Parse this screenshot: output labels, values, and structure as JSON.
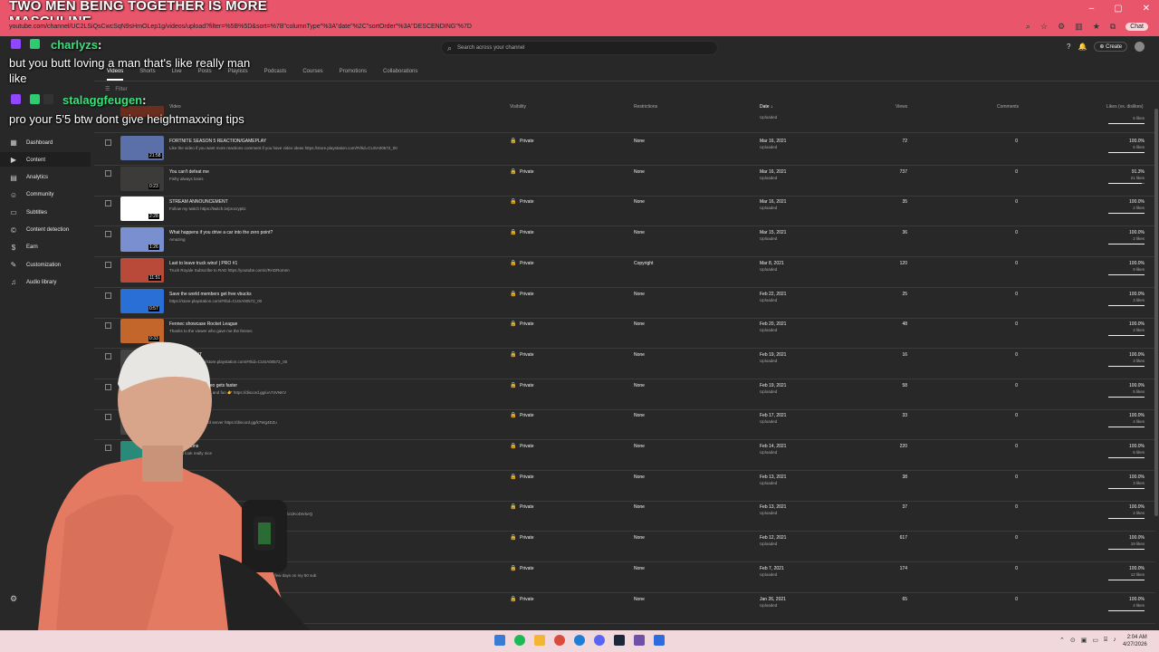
{
  "overlay": {
    "stream_title_line1": "TWO MEN BEING TOGETHER IS MORE",
    "stream_title_line2": "MASCULINE",
    "chat": [
      {
        "user": "charlyzs",
        "colon": ":",
        "msg_line1": "but you butt loving a man that's like really man",
        "msg_line2": "like"
      },
      {
        "user": "stalaggfeugen",
        "colon": ":",
        "msg_line1": "pro your 5'5 btw dont give heightmaxxing tips"
      }
    ]
  },
  "browser": {
    "url": "youtube.com/channel/UC2LSiQsCwcSqN9sHmOLep1g/videos/upload?filter=%5B%5D&sort=%7B\"columnType\"%3A\"date\"%2C\"sortOrder\"%3A\"DESCENDING\"%7D",
    "chat_btn": "Chat",
    "win_min": "–",
    "win_max": "▢",
    "win_close": "✕"
  },
  "header": {
    "search_placeholder": "Search across your channel",
    "create_label": "Create",
    "help_icon": "?",
    "bell_icon": "🔔"
  },
  "sidebar": {
    "items": [
      {
        "label": "Dashboard",
        "icon": "▦"
      },
      {
        "label": "Content",
        "icon": "▶"
      },
      {
        "label": "Analytics",
        "icon": "▤"
      },
      {
        "label": "Community",
        "icon": "☺"
      },
      {
        "label": "Subtitles",
        "icon": "▭"
      },
      {
        "label": "Content detection",
        "icon": "©"
      },
      {
        "label": "Earn",
        "icon": "$"
      },
      {
        "label": "Customization",
        "icon": "✎"
      },
      {
        "label": "Audio library",
        "icon": "♫"
      }
    ],
    "gear": "⚙"
  },
  "tabs": [
    "Videos",
    "Shorts",
    "Live",
    "Posts",
    "Playlists",
    "Podcasts",
    "Courses",
    "Promotions",
    "Collaborations"
  ],
  "filter_label": "Filter",
  "columns": {
    "video": "Video",
    "visibility": "Visibility",
    "restrictions": "Restrictions",
    "date": "Date ↓",
    "views": "Views",
    "comments": "Comments",
    "likes": "Likes (vs. dislikes)"
  },
  "partial_row": {
    "status": "Uploaded",
    "likecnt": "5 likes"
  },
  "rows": [
    {
      "title": "FORTNITE SEASON 5 REACTION/GAMEPLAY",
      "desc": "Like the video if you want more reactions comment if you have video ideas https://store.playstation.com/#!/tid=CUSA00572_00",
      "dur": "21:58",
      "vis": "Private",
      "restr": "None",
      "date": "Mar 16, 2021",
      "status": "Uploaded",
      "views": "72",
      "comments": "0",
      "likes": "100.0%",
      "likecnt": "5 likes",
      "ratio": 1.0,
      "color": "#5b6fa8"
    },
    {
      "title": "You can't defeat me",
      "desc": "Fishy always loses",
      "dur": "0:23",
      "vis": "Private",
      "restr": "None",
      "date": "Mar 16, 2021",
      "status": "Uploaded",
      "views": "737",
      "comments": "0",
      "likes": "91.3%",
      "likecnt": "21 likes",
      "ratio": 0.913,
      "color": "#3d3a3a"
    },
    {
      "title": "STREAM ANNOUNCEMENT",
      "desc": "Follow my twitch https://twitch.tv/procryptic",
      "dur": "2:28",
      "vis": "Private",
      "restr": "None",
      "date": "Mar 16, 2021",
      "status": "Uploaded",
      "views": "35",
      "comments": "0",
      "likes": "100.0%",
      "likecnt": "2 likes",
      "ratio": 1.0,
      "color": "#ffffff"
    },
    {
      "title": "What happens if you drive a car into the zero point?",
      "desc": "Amazing",
      "dur": "1:26",
      "vis": "Private",
      "restr": "None",
      "date": "Mar 15, 2021",
      "status": "Uploaded",
      "views": "36",
      "comments": "0",
      "likes": "100.0%",
      "likecnt": "2 likes",
      "ratio": 1.0,
      "color": "#7a8fd0"
    },
    {
      "title": "Last to leave truck wins! | PRO #1",
      "desc": "Truck Royale Subscribe to RAD https://youtube.com/c/RADRomen",
      "dur": "11:51",
      "vis": "Private",
      "restr": "Copyright",
      "date": "Mar 8, 2021",
      "status": "Uploaded",
      "views": "120",
      "comments": "0",
      "likes": "100.0%",
      "likecnt": "9 likes",
      "ratio": 1.0,
      "color": "#b94a3a"
    },
    {
      "title": "Save the world members get free vbucks",
      "desc": "https://store.playstation.com/#!/tid=CUSA00572_00",
      "dur": "0:57",
      "vis": "Private",
      "restr": "None",
      "date": "Feb 22, 2021",
      "status": "Uploaded",
      "views": "25",
      "comments": "0",
      "likes": "100.0%",
      "likecnt": "3 likes",
      "ratio": 1.0,
      "color": "#2a6fd6"
    },
    {
      "title": "Fennec showcase Rocket League",
      "desc": "Thanks to the viewer who gave me the fennec",
      "dur": "0:33",
      "vis": "Private",
      "restr": "None",
      "date": "Feb 20, 2021",
      "status": "Uploaded",
      "views": "48",
      "comments": "0",
      "likes": "100.0%",
      "likecnt": "3 likes",
      "ratio": 1.0,
      "color": "#c2662c"
    },
    {
      "title": "craft MANHUNT",
      "desc": "on this time... https://store.playstation.com/#!/tid=CUSA00572_00",
      "dur": "",
      "vis": "Private",
      "restr": "None",
      "date": "Feb 19, 2021",
      "status": "Uploaded",
      "views": "16",
      "comments": "0",
      "likes": "100.0%",
      "likecnt": "3 likes",
      "ratio": 1.0,
      "color": "#444"
    },
    {
      "title": "ery time I die the video gets faster",
      "desc": "server for more content and fun 👉 https://discord.gg/uA74VNKV",
      "dur": "",
      "vis": "Private",
      "restr": "None",
      "date": "Feb 19, 2021",
      "status": "Uploaded",
      "views": "58",
      "comments": "0",
      "likes": "100.0%",
      "likecnt": "5 likes",
      "ratio": 1.0,
      "color": "#444"
    },
    {
      "title": "",
      "desc": "here is my new discord server https://discord.gg/k7Wg4EZu",
      "dur": "",
      "vis": "Private",
      "restr": "None",
      "date": "Feb 17, 2021",
      "status": "Uploaded",
      "views": "33",
      "comments": "0",
      "likes": "100.0%",
      "likecnt": "4 likes",
      "ratio": 1.0,
      "color": "#444"
    },
    {
      "title": "dle Transitions",
      "desc": "ons that look really nice",
      "dur": "",
      "vis": "Private",
      "restr": "None",
      "date": "Feb 14, 2021",
      "status": "Uploaded",
      "views": "220",
      "comments": "0",
      "likes": "100.0%",
      "likecnt": "5 likes",
      "ratio": 1.0,
      "color": "#2a8a7a"
    },
    {
      "title": "re",
      "desc": "",
      "dur": "",
      "vis": "Private",
      "restr": "None",
      "date": "Feb 13, 2021",
      "status": "Uploaded",
      "views": "38",
      "comments": "0",
      "likes": "100.0%",
      "likecnt": "3 likes",
      "ratio": 1.0,
      "color": "#444"
    },
    {
      "title": "",
      "desc": "t map in 10 minutes. Go sub to big allbug gaming https://youtu.be/x1tKoDnrkeQ",
      "dur": "",
      "vis": "Private",
      "restr": "None",
      "date": "Feb 13, 2021",
      "status": "Uploaded",
      "views": "37",
      "comments": "0",
      "likes": "100.0%",
      "likecnt": "2 likes",
      "ratio": 1.0,
      "color": "#444"
    },
    {
      "title": "",
      "desc": "",
      "dur": "",
      "vis": "Private",
      "restr": "None",
      "date": "Feb 12, 2021",
      "status": "Uploaded",
      "views": "617",
      "comments": "0",
      "likes": "100.0%",
      "likecnt": "19 likes",
      "ratio": 1.0,
      "color": "#444"
    },
    {
      "title": "",
      "desc": "tips from chapter 1 and 2 Also I decided to spend an extra few days on my 50 sub",
      "dur": "",
      "vis": "Private",
      "restr": "None",
      "date": "Feb 7, 2021",
      "status": "Uploaded",
      "views": "174",
      "comments": "0",
      "likes": "100.0%",
      "likecnt": "12 likes",
      "ratio": 1.0,
      "color": "#444"
    },
    {
      "title": "32 bits 6",
      "desc": "",
      "dur": "",
      "vis": "Private",
      "restr": "None",
      "date": "Jan 26, 2021",
      "status": "Uploaded",
      "views": "65",
      "comments": "0",
      "likes": "100.0%",
      "likecnt": "4 likes",
      "ratio": 1.0,
      "color": "#444"
    }
  ],
  "taskbar": {
    "time": "2:04 AM",
    "date": "4/27/2026"
  },
  "colors": {
    "accent": "#e9556b",
    "chat_name": "#3ce07a",
    "twitch": "#9146ff",
    "yt_bg": "#282828"
  }
}
